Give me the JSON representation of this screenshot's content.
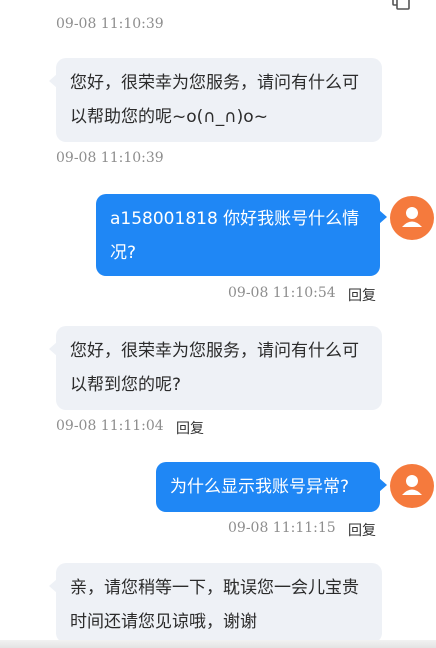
{
  "messages": [
    {
      "sender": "agent",
      "time": "09-08 11:10:39"
    },
    {
      "sender": "agent",
      "text": "您好，很荣幸为您服务，请问有什么可以帮助您的呢~o(∩_∩)o~",
      "time": "09-08 11:10:39"
    },
    {
      "sender": "user",
      "text": "a158001818 你好我账号什么情况?",
      "time": "09-08 11:10:54",
      "action": "回复"
    },
    {
      "sender": "agent",
      "text": "您好，很荣幸为您服务，请问有什么可以帮到您的呢?",
      "time": "09-08 11:11:04",
      "action": "回复"
    },
    {
      "sender": "user",
      "text": "为什么显示我账号异常?",
      "time": "09-08 11:11:15",
      "action": "回复"
    },
    {
      "sender": "agent",
      "text": "亲，请您稍等一下，耽误您一会儿宝贵时间还请您见谅哦，谢谢"
    }
  ],
  "icons": {
    "user_avatar": "user-avatar-icon",
    "corner": "copy-icon"
  },
  "colors": {
    "user_bubble": "#1f87f5",
    "agent_bubble": "#eef1f6",
    "avatar": "#f57a3d",
    "timestamp": "#8e8e8e"
  }
}
